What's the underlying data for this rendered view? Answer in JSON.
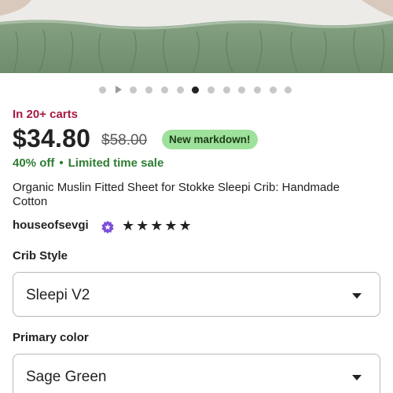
{
  "gallery": {
    "image_alt": "green muslin crib sheet",
    "dots_count": 13,
    "active_index": 6,
    "play_index": 1
  },
  "listing": {
    "carts_text": "In 20+ carts",
    "price": "$34.80",
    "original_price": "$58.00",
    "badge": "New markdown!",
    "discount": "40% off",
    "sale_text": "Limited time sale",
    "separator": "•",
    "title": "Organic Muslin Fitted Sheet for Stokke Sleepi Crib: Handmade Cotton",
    "shop_name": "houseofsevgi",
    "rating": "★★★★★"
  },
  "options": {
    "crib_style": {
      "label": "Crib Style",
      "value": "Sleepi V2"
    },
    "primary_color": {
      "label": "Primary color",
      "value": "Sage Green"
    }
  },
  "colors": {
    "sale_red": "#a61a3f",
    "discount_green": "#2f7d32",
    "badge_green": "#9ee19a",
    "star_seller_purple": "#7c4dd6"
  }
}
